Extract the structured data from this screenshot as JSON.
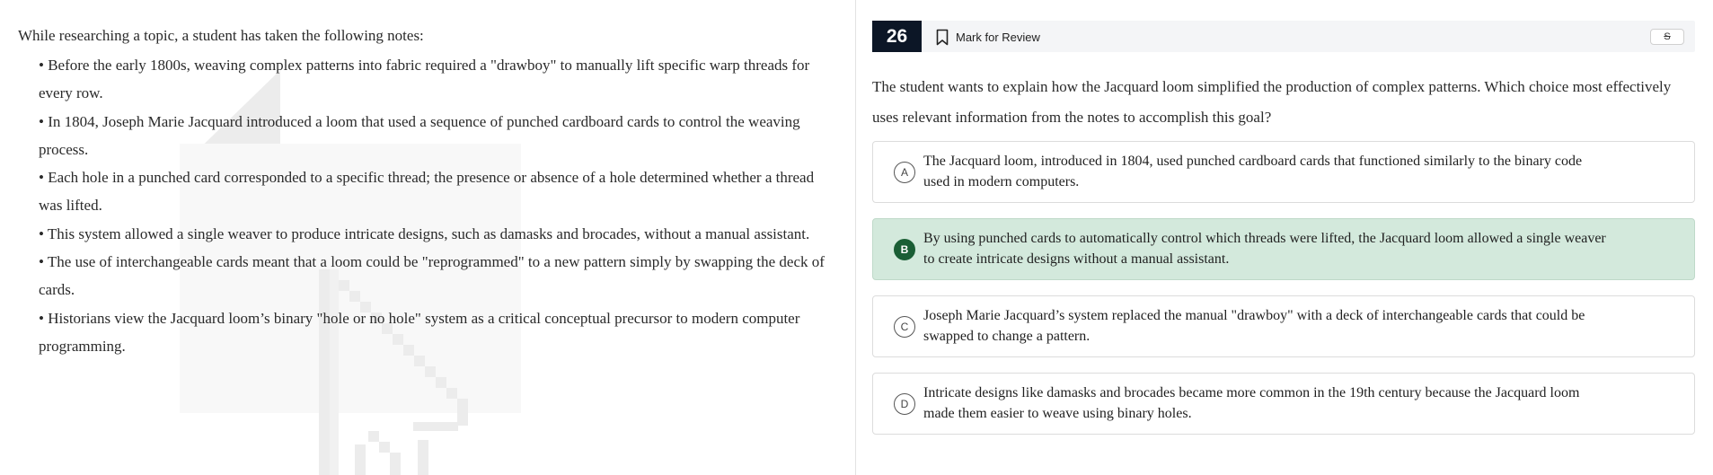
{
  "notes": {
    "intro": "While researching a topic, a student has taken the following notes:",
    "items": [
      "• Before the early 1800s, weaving complex patterns into fabric required a \"drawboy\" to manually lift specific warp threads for",
      "every row.",
      "• In 1804, Joseph Marie Jacquard introduced a loom that used a sequence of punched cardboard cards to control the weaving",
      "process.",
      "• Each hole in a punched card corresponded to a specific thread; the presence or absence of a hole determined whether a thread",
      "was lifted.",
      "• This system allowed a single weaver to produce intricate designs, such as damasks and brocades, without a manual assistant.",
      "• The use of interchangeable cards meant that a loom could be \"reprogrammed\" to a new pattern simply by swapping the deck of",
      "cards.",
      "• Historians view the Jacquard loom’s binary \"hole or no hole\" system as a critical conceptual precursor to modern computer",
      "programming."
    ]
  },
  "header": {
    "question_number": "26",
    "mark_for_review": "Mark for Review",
    "strike_tool": "S",
    "bookmark_icon": "bookmark-icon"
  },
  "question": {
    "text": "The student wants to explain how the Jacquard loom simplified the production of complex patterns. Which choice most effectively uses relevant information from the notes to accomplish this goal?"
  },
  "choices": [
    {
      "letter": "A",
      "line1": "The Jacquard loom, introduced in 1804, used punched cardboard cards that functioned similarly to the binary code",
      "line2": "used in modern computers.",
      "selected": false
    },
    {
      "letter": "B",
      "line1": "By using punched cards to automatically control which threads were lifted, the Jacquard loom allowed a single weaver",
      "line2": "to create intricate designs without a manual assistant.",
      "selected": true
    },
    {
      "letter": "C",
      "line1": "Joseph Marie Jacquard’s system replaced the manual \"drawboy\" with a deck of interchangeable cards that could be",
      "line2": "swapped to change a pattern.",
      "selected": false
    },
    {
      "letter": "D",
      "line1": "Intricate designs like damasks and brocades became more common in the 19th century because the Jacquard loom",
      "line2": "made them easier to weave using binary holes.",
      "selected": false
    }
  ],
  "colors": {
    "question_number_bg": "#0c1626",
    "selected_bg": "#d3e9dc",
    "selected_badge": "#1a5e35",
    "watermark": "#ececec"
  }
}
